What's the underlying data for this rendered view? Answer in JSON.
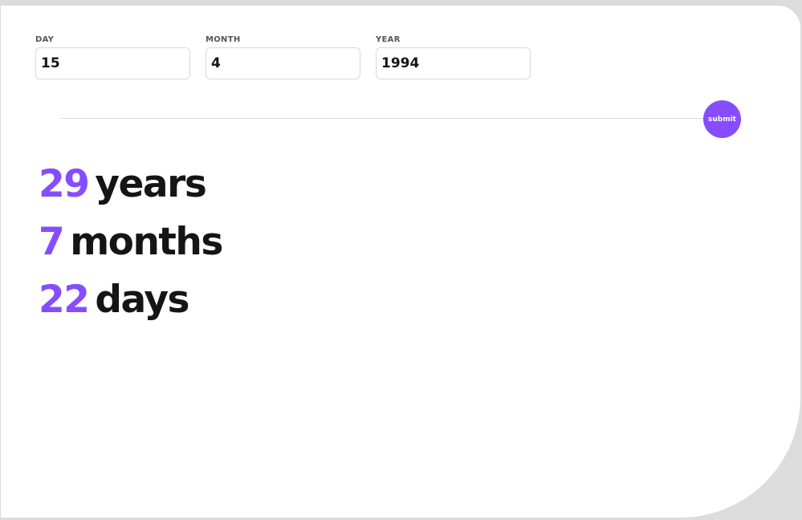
{
  "form": {
    "day": {
      "label": "DAY",
      "value": "15"
    },
    "month": {
      "label": "MONTH",
      "value": "4"
    },
    "year": {
      "label": "YEAR",
      "value": "1994"
    },
    "submit_label": "submit"
  },
  "results": {
    "years": {
      "value": "29",
      "unit": "years"
    },
    "months": {
      "value": "7",
      "unit": "months"
    },
    "days": {
      "value": "22",
      "unit": "days"
    }
  },
  "colors": {
    "accent": "#854dff",
    "text": "#151515",
    "label": "#555555",
    "border": "#d9d9d9",
    "page_background": "#dcdcdc"
  }
}
